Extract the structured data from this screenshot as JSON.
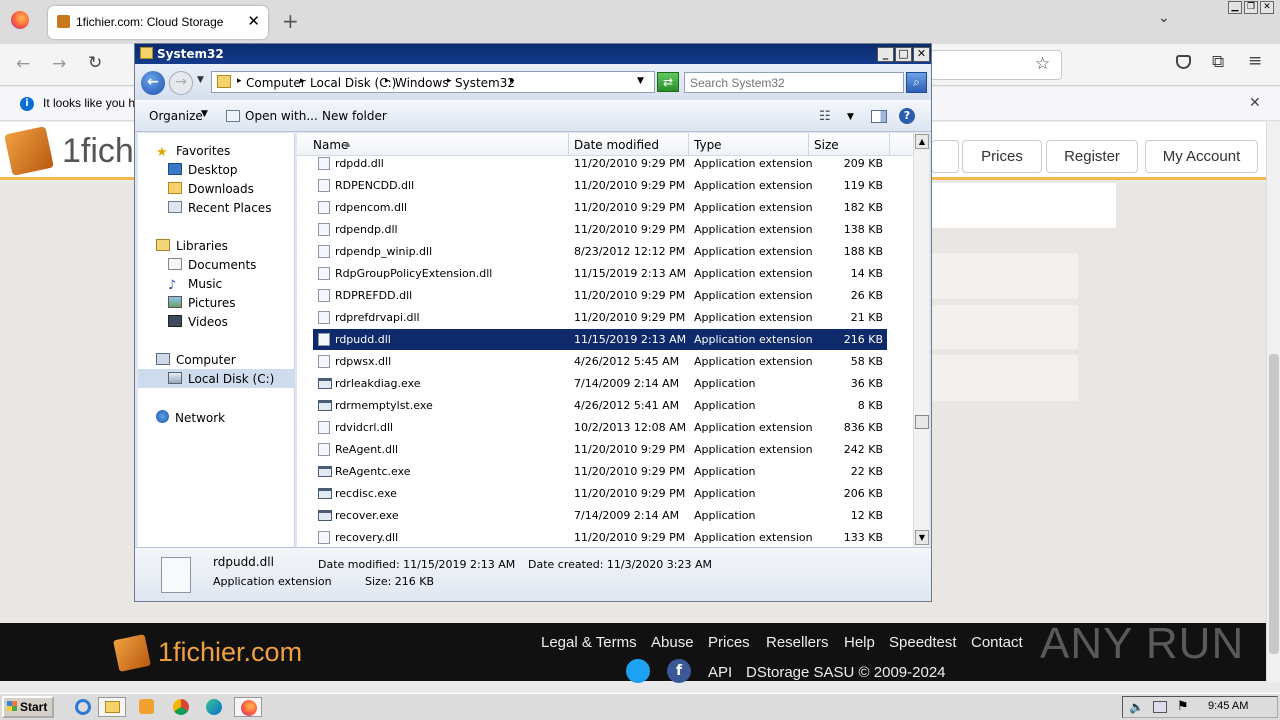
{
  "browser": {
    "tab_title": "1fichier.com: Cloud Storage",
    "notification": "It looks like you ha"
  },
  "site": {
    "logo_text": "1fich",
    "nav": [
      "Prices",
      "Register",
      "My Account"
    ],
    "footer_logo": "1fichier.com",
    "footer_links": [
      "Legal & Terms",
      "Abuse",
      "Prices",
      "Resellers",
      "Help",
      "Speedtest",
      "Contact"
    ],
    "footer_api": "API",
    "footer_copyright": "DStorage SASU © 2009-2024",
    "watermark": "ANY RUN"
  },
  "explorer": {
    "title": "System32",
    "breadcrumbs": [
      "Computer",
      "Local Disk (C:)",
      "Windows",
      "System32"
    ],
    "search_placeholder": "Search System32",
    "toolbar": {
      "organize": "Organize",
      "open_with": "Open with...",
      "new_folder": "New folder"
    },
    "nav": {
      "favorites": "Favorites",
      "favorites_items": [
        "Desktop",
        "Downloads",
        "Recent Places"
      ],
      "libraries": "Libraries",
      "libraries_items": [
        "Documents",
        "Music",
        "Pictures",
        "Videos"
      ],
      "computer": "Computer",
      "local_disk": "Local Disk (C:)",
      "network": "Network"
    },
    "columns": {
      "name": "Name",
      "date": "Date modified",
      "type": "Type",
      "size": "Size"
    },
    "files": [
      {
        "name": "rdpdd.dll",
        "date": "11/20/2010 9:29 PM",
        "type": "Application extension",
        "size": "209 KB",
        "kind": "dll"
      },
      {
        "name": "RDPENCDD.dll",
        "date": "11/20/2010 9:29 PM",
        "type": "Application extension",
        "size": "119 KB",
        "kind": "dll"
      },
      {
        "name": "rdpencom.dll",
        "date": "11/20/2010 9:29 PM",
        "type": "Application extension",
        "size": "182 KB",
        "kind": "dll"
      },
      {
        "name": "rdpendp.dll",
        "date": "11/20/2010 9:29 PM",
        "type": "Application extension",
        "size": "138 KB",
        "kind": "dll"
      },
      {
        "name": "rdpendp_winip.dll",
        "date": "8/23/2012 12:12 PM",
        "type": "Application extension",
        "size": "188 KB",
        "kind": "dll"
      },
      {
        "name": "RdpGroupPolicyExtension.dll",
        "date": "11/15/2019 2:13 AM",
        "type": "Application extension",
        "size": "14 KB",
        "kind": "dll"
      },
      {
        "name": "RDPREFDD.dll",
        "date": "11/20/2010 9:29 PM",
        "type": "Application extension",
        "size": "26 KB",
        "kind": "dll"
      },
      {
        "name": "rdprefdrvapi.dll",
        "date": "11/20/2010 9:29 PM",
        "type": "Application extension",
        "size": "21 KB",
        "kind": "dll"
      },
      {
        "name": "rdpudd.dll",
        "date": "11/15/2019 2:13 AM",
        "type": "Application extension",
        "size": "216 KB",
        "kind": "dll",
        "selected": true
      },
      {
        "name": "rdpwsx.dll",
        "date": "4/26/2012 5:45 AM",
        "type": "Application extension",
        "size": "58 KB",
        "kind": "dll"
      },
      {
        "name": "rdrleakdiag.exe",
        "date": "7/14/2009 2:14 AM",
        "type": "Application",
        "size": "36 KB",
        "kind": "exe"
      },
      {
        "name": "rdrmemptylst.exe",
        "date": "4/26/2012 5:41 AM",
        "type": "Application",
        "size": "8 KB",
        "kind": "exe"
      },
      {
        "name": "rdvidcrl.dll",
        "date": "10/2/2013 12:08 AM",
        "type": "Application extension",
        "size": "836 KB",
        "kind": "dll"
      },
      {
        "name": "ReAgent.dll",
        "date": "11/20/2010 9:29 PM",
        "type": "Application extension",
        "size": "242 KB",
        "kind": "dll"
      },
      {
        "name": "ReAgentc.exe",
        "date": "11/20/2010 9:29 PM",
        "type": "Application",
        "size": "22 KB",
        "kind": "exe"
      },
      {
        "name": "recdisc.exe",
        "date": "11/20/2010 9:29 PM",
        "type": "Application",
        "size": "206 KB",
        "kind": "exe"
      },
      {
        "name": "recover.exe",
        "date": "7/14/2009 2:14 AM",
        "type": "Application",
        "size": "12 KB",
        "kind": "exe"
      },
      {
        "name": "recovery.dll",
        "date": "11/20/2010 9:29 PM",
        "type": "Application extension",
        "size": "133 KB",
        "kind": "dll"
      }
    ],
    "details": {
      "name": "rdpudd.dll",
      "type": "Application extension",
      "modified": "Date modified: 11/15/2019 2:13 AM",
      "created": "Date created: 11/3/2020 3:23 AM",
      "size": "Size: 216 KB"
    }
  },
  "taskbar": {
    "start": "Start",
    "clock": "9:45 AM"
  }
}
